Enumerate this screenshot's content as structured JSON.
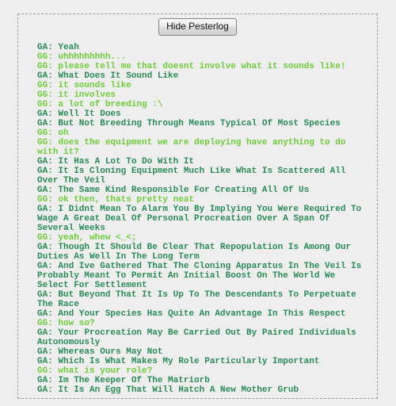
{
  "window": {
    "background_color": "#eeeeee"
  },
  "pesterlog": {
    "container_name": "pesterlog",
    "border_color": "#9a9a9a",
    "toggle_button": {
      "label": "Hide Pesterlog"
    },
    "speakers": {
      "GA": {
        "handle": "GA",
        "color": "#2a8b57"
      },
      "GG": {
        "handle": "GG",
        "color": "#6ecc3a"
      }
    },
    "lines": [
      {
        "speaker": "GA",
        "text": "GA: Yeah"
      },
      {
        "speaker": "GG",
        "text": "GG: uhhhhhhhhh..."
      },
      {
        "speaker": "GG",
        "text": "GG: please tell me that doesnt involve what it sounds like!"
      },
      {
        "speaker": "GA",
        "text": "GA: What Does It Sound Like"
      },
      {
        "speaker": "GG",
        "text": "GG: it sounds like"
      },
      {
        "speaker": "GG",
        "text": "GG: it involves"
      },
      {
        "speaker": "GG",
        "text": "GG: a lot of breeding :\\"
      },
      {
        "speaker": "GA",
        "text": "GA: Well It Does"
      },
      {
        "speaker": "GA",
        "text": "GA: But Not Breeding Through Means Typical Of Most Species"
      },
      {
        "speaker": "GG",
        "text": "GG: oh"
      },
      {
        "speaker": "GG",
        "text": "GG: does the equipment we are deploying have anything to do with it?"
      },
      {
        "speaker": "GA",
        "text": "GA: It Has A Lot To Do With It"
      },
      {
        "speaker": "GA",
        "text": "GA: It Is Cloning Equipment Much Like What Is Scattered All Over The Veil"
      },
      {
        "speaker": "GA",
        "text": "GA: The Same Kind Responsible For Creating All Of Us"
      },
      {
        "speaker": "GG",
        "text": "GG: ok then, thats pretty neat"
      },
      {
        "speaker": "GA",
        "text": "GA: I Didnt Mean To Alarm You By Implying You Were Required To Wage A Great Deal Of Personal Procreation Over A Span Of Several Weeks"
      },
      {
        "speaker": "GG",
        "text": "GG: yeah, whew <_<;"
      },
      {
        "speaker": "GA",
        "text": "GA: Though It Should Be Clear That Repopulation Is Among Our Duties As Well In The Long Term"
      },
      {
        "speaker": "GA",
        "text": "GA: And Ive Gathered That The Cloning Apparatus In The Veil Is Probably Meant To Permit An Initial Boost On The World We Select For Settlement"
      },
      {
        "speaker": "GA",
        "text": "GA: But Beyond That It Is Up To The Descendants To Perpetuate The Race"
      },
      {
        "speaker": "GA",
        "text": "GA: And Your Species Has Quite An Advantage In This Respect"
      },
      {
        "speaker": "GG",
        "text": "GG: how so?"
      },
      {
        "speaker": "GA",
        "text": "GA: Your Procreation May Be Carried Out By Paired Individuals Autonomously"
      },
      {
        "speaker": "GA",
        "text": "GA: Whereas Ours May Not"
      },
      {
        "speaker": "GA",
        "text": "GA: Which Is What Makes My Role Particularly Important"
      },
      {
        "speaker": "GG",
        "text": "GG: what is your role?"
      },
      {
        "speaker": "GA",
        "text": "GA: Im The Keeper Of The Matriorb"
      },
      {
        "speaker": "GA",
        "text": "GA: It Is An Egg That Will Hatch A New Mother Grub"
      }
    ]
  }
}
